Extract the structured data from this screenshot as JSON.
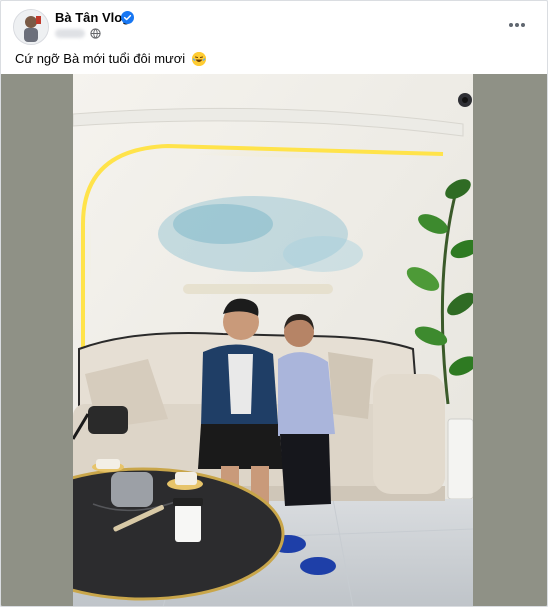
{
  "post": {
    "author": "Bà Tân Vlog",
    "caption": "Cứ ngỡ Bà mới tuổi đôi mươi",
    "emoji": "laughing-face",
    "verified": true,
    "privacy_icon": "globe-icon",
    "more_icon": "more-options-icon"
  },
  "colors": {
    "author_text": "#050505",
    "verified_blue": "#1877f2",
    "card_bg": "#ffffff",
    "photo_side_bg": "#8f9186"
  }
}
